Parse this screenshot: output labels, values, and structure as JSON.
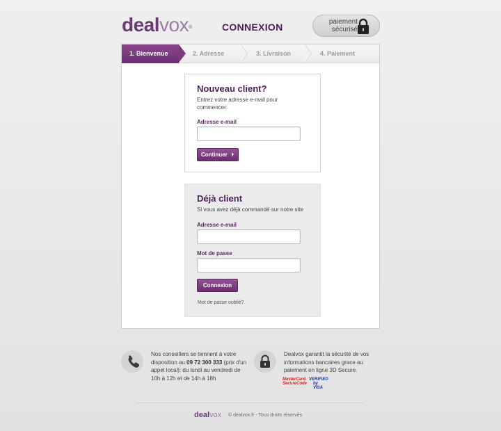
{
  "header": {
    "logo_main": "deal",
    "logo_accent": "vox",
    "logo_mark": "®",
    "title": "CONNEXION",
    "secure_line1": "paiement",
    "secure_line2": "sécurisé"
  },
  "steps": [
    {
      "label": "1. Bienvenue",
      "active": true
    },
    {
      "label": "2. Adresse",
      "active": false
    },
    {
      "label": "3. Livraison",
      "active": false
    },
    {
      "label": "4. Paiement",
      "active": false
    }
  ],
  "new_client": {
    "title": "Nouveau client?",
    "subtitle": "Entrez votre adresse e-mail pour commencer:",
    "email_label": "Adresse e-mail",
    "email_value": "",
    "continue_label": "Continuer"
  },
  "existing_client": {
    "title": "Déjà client",
    "subtitle": "Si vous avez déjà commandé sur notre site",
    "email_label": "Adresse e-mail",
    "email_value": "",
    "password_label": "Mot de passe",
    "password_value": "",
    "login_label": "Connexion",
    "forgot_label": "Mot de passe oublié?"
  },
  "info": {
    "phone_text_1": "Nos conseillers se tiennent à votre disposition au ",
    "phone_number": "09 72 300 333",
    "phone_text_2": " (prix d'un appel local): du lundi au vendredi de 10h à 12h et de 14h à 18h",
    "security_text": "Dealvox garantit la sécurité de vos informations bancaires grace au paiement en ligne 3D Secure.",
    "mastercard_1": "MasterCard.",
    "mastercard_2": "SecureCode",
    "visa_1": "VERIFIED",
    "visa_2": "by VISA"
  },
  "footer": {
    "logo_main": "deal",
    "logo_accent": "vox",
    "copyright": "© dealvox.fr - Tous droits réservés"
  },
  "colors": {
    "brand": "#6a3a73",
    "brand_light": "#9a7ca2",
    "title": "#4b1f57"
  },
  "icons": [
    "lock-icon",
    "phone-icon",
    "chevron-right-icon"
  ]
}
